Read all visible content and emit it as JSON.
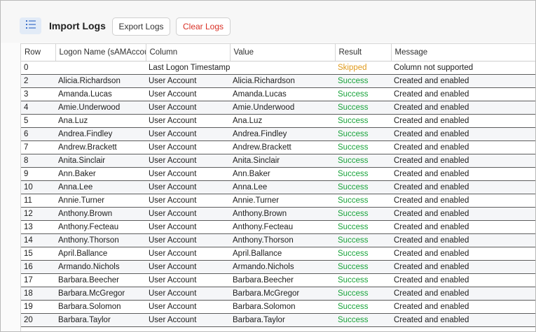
{
  "toolbar": {
    "title": "Import Logs",
    "export_label": "Export Logs",
    "clear_label": "Clear Logs",
    "menu_icon": "list-icon",
    "accent_color": "#e2ebf7",
    "clear_color": "#d93025"
  },
  "table": {
    "columns": [
      "Row",
      "Logon Name (sAMAccountName)",
      "Column",
      "Value",
      "Result",
      "Message"
    ],
    "rows": [
      [
        "0",
        "",
        "Last Logon Timestamp",
        "",
        "Skipped",
        "Column not supported"
      ],
      [
        "2",
        "Alicia.Richardson",
        "User Account",
        "Alicia.Richardson",
        "Success",
        "Created and enabled"
      ],
      [
        "3",
        "Amanda.Lucas",
        "User Account",
        "Amanda.Lucas",
        "Success",
        "Created and enabled"
      ],
      [
        "4",
        "Amie.Underwood",
        "User Account",
        "Amie.Underwood",
        "Success",
        "Created and enabled"
      ],
      [
        "5",
        "Ana.Luz",
        "User Account",
        "Ana.Luz",
        "Success",
        "Created and enabled"
      ],
      [
        "6",
        "Andrea.Findley",
        "User Account",
        "Andrea.Findley",
        "Success",
        "Created and enabled"
      ],
      [
        "7",
        "Andrew.Brackett",
        "User Account",
        "Andrew.Brackett",
        "Success",
        "Created and enabled"
      ],
      [
        "8",
        "Anita.Sinclair",
        "User Account",
        "Anita.Sinclair",
        "Success",
        "Created and enabled"
      ],
      [
        "9",
        "Ann.Baker",
        "User Account",
        "Ann.Baker",
        "Success",
        "Created and enabled"
      ],
      [
        "10",
        "Anna.Lee",
        "User Account",
        "Anna.Lee",
        "Success",
        "Created and enabled"
      ],
      [
        "11",
        "Annie.Turner",
        "User Account",
        "Annie.Turner",
        "Success",
        "Created and enabled"
      ],
      [
        "12",
        "Anthony.Brown",
        "User Account",
        "Anthony.Brown",
        "Success",
        "Created and enabled"
      ],
      [
        "13",
        "Anthony.Fecteau",
        "User Account",
        "Anthony.Fecteau",
        "Success",
        "Created and enabled"
      ],
      [
        "14",
        "Anthony.Thorson",
        "User Account",
        "Anthony.Thorson",
        "Success",
        "Created and enabled"
      ],
      [
        "15",
        "April.Ballance",
        "User Account",
        "April.Ballance",
        "Success",
        "Created and enabled"
      ],
      [
        "16",
        "Armando.Nichols",
        "User Account",
        "Armando.Nichols",
        "Success",
        "Created and enabled"
      ],
      [
        "17",
        "Barbara.Beecher",
        "User Account",
        "Barbara.Beecher",
        "Success",
        "Created and enabled"
      ],
      [
        "18",
        "Barbara.McGregor",
        "User Account",
        "Barbara.McGregor",
        "Success",
        "Created and enabled"
      ],
      [
        "19",
        "Barbara.Solomon",
        "User Account",
        "Barbara.Solomon",
        "Success",
        "Created and enabled"
      ],
      [
        "20",
        "Barbara.Taylor",
        "User Account",
        "Barbara.Taylor",
        "Success",
        "Created and enabled"
      ]
    ]
  }
}
